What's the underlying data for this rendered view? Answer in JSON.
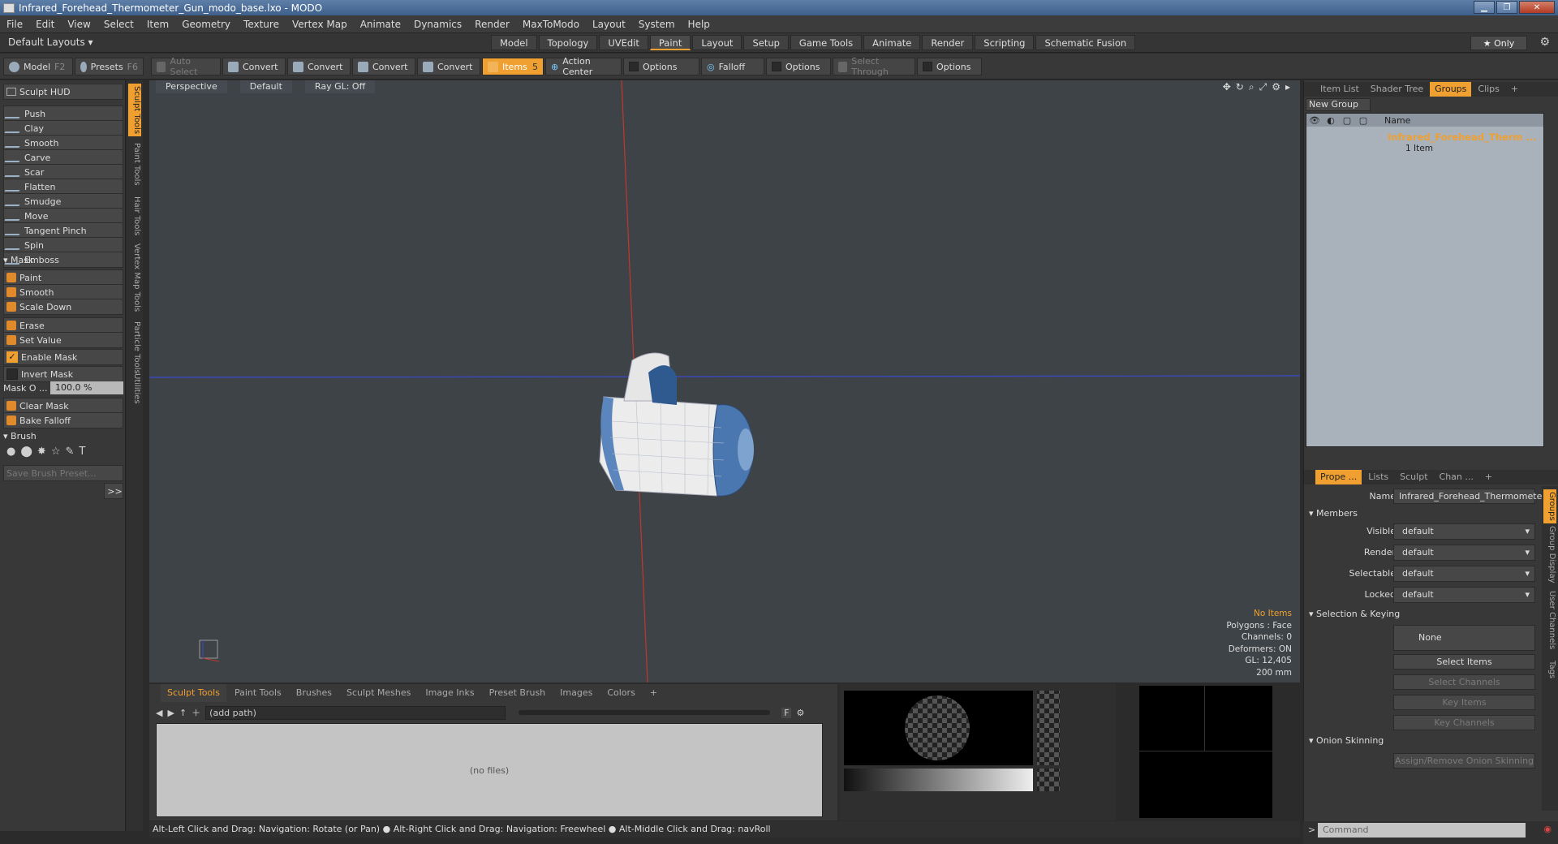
{
  "window": {
    "title": "Infrared_Forehead_Thermometer_Gun_modo_base.lxo - MODO"
  },
  "menu": [
    "File",
    "Edit",
    "View",
    "Select",
    "Item",
    "Geometry",
    "Texture",
    "Vertex Map",
    "Animate",
    "Dynamics",
    "Render",
    "MaxToModo",
    "Layout",
    "System",
    "Help"
  ],
  "layoutbar": {
    "layouts_label": "Default Layouts ▾",
    "tabs": [
      "Model",
      "Topology",
      "UVEdit",
      "Paint",
      "Layout",
      "Setup",
      "Game Tools",
      "Animate",
      "Render",
      "Scripting",
      "Schematic Fusion"
    ],
    "active_tab": "Paint",
    "only_label": "★ Only"
  },
  "toolbar": {
    "model": "Model",
    "model_key": "F2",
    "presets": "Presets",
    "presets_key": "F6",
    "auto_select": "Auto Select",
    "convert": "Convert",
    "items": "Items",
    "items_key": "5",
    "action_center": "Action Center",
    "options": "Options",
    "falloff": "Falloff",
    "select_through": "Select Through"
  },
  "left": {
    "sculpt_hud": "Sculpt HUD",
    "tools": [
      "Push",
      "Clay",
      "Smooth",
      "Carve",
      "Scar",
      "Flatten",
      "Smudge",
      "Move",
      "Tangent Pinch",
      "Spin",
      "Emboss"
    ],
    "mask_header": "Mask",
    "mask_tools": [
      "Paint",
      "Smooth",
      "Scale Down"
    ],
    "erase": "Erase",
    "set_value": "Set Value",
    "enable_mask": "Enable Mask",
    "invert_mask": "Invert Mask",
    "mask_opacity_label": "Mask O ...",
    "mask_opacity_value": "100.0 %",
    "clear_mask": "Clear Mask",
    "bake_falloff": "Bake Falloff",
    "brush_header": "Brush",
    "save_brush": "Save Brush Preset...",
    "more": ">>",
    "vtabs": [
      "Sculpt Tools",
      "Paint Tools",
      "Hair Tools",
      "Vertex Map Tools",
      "Particle Tools",
      "Utilities"
    ]
  },
  "viewport": {
    "view": "Perspective",
    "shading": "Default",
    "raygl": "Ray GL: Off",
    "stats": [
      "No Items",
      "Polygons : Face",
      "Channels: 0",
      "Deformers: ON",
      "GL: 12,405",
      "200 mm"
    ]
  },
  "hint": "Alt-Left Click and Drag: Navigation: Rotate (or Pan) ● Alt-Right Click and Drag: Navigation: Freewheel ● Alt-Middle Click and Drag: navRoll",
  "bottom": {
    "tabs": [
      "Sculpt Tools",
      "Paint Tools",
      "Brushes",
      "Sculpt Meshes",
      "Image Inks",
      "Preset Brush",
      "Images",
      "Colors",
      "+"
    ],
    "path": "(add path)",
    "no_files": "(no files)",
    "f_label": "F"
  },
  "right": {
    "top_tabs": [
      "Item List",
      "Shader Tree",
      "Groups",
      "Clips",
      "+"
    ],
    "active_top": "Groups",
    "new_group": "New Group",
    "col_name": "Name",
    "group_name": "Infrared_Forehead_Therm ...",
    "group_count": "1 Item",
    "prop_tabs": [
      "Prope ...",
      "Lists",
      "Sculpt",
      "Chan ...",
      "+"
    ],
    "name_label": "Name",
    "name_value": "Infrared_Forehead_Thermometer",
    "members": "Members",
    "props": [
      {
        "label": "Visible",
        "value": "default"
      },
      {
        "label": "Render",
        "value": "default"
      },
      {
        "label": "Selectable",
        "value": "default"
      },
      {
        "label": "Locked",
        "value": "default"
      }
    ],
    "sel_keying": "Selection & Keying",
    "none": "None",
    "select_items": "Select Items",
    "select_channels": "Select Channels",
    "key_items": "Key Items",
    "key_channels": "Key Channels",
    "onion": "Onion Skinning",
    "assign_onion": "Assign/Remove Onion Skinning",
    "vtabs": [
      "Groups",
      "Group Display",
      "User Channels",
      "Tags"
    ],
    "command_placeholder": "Command"
  }
}
